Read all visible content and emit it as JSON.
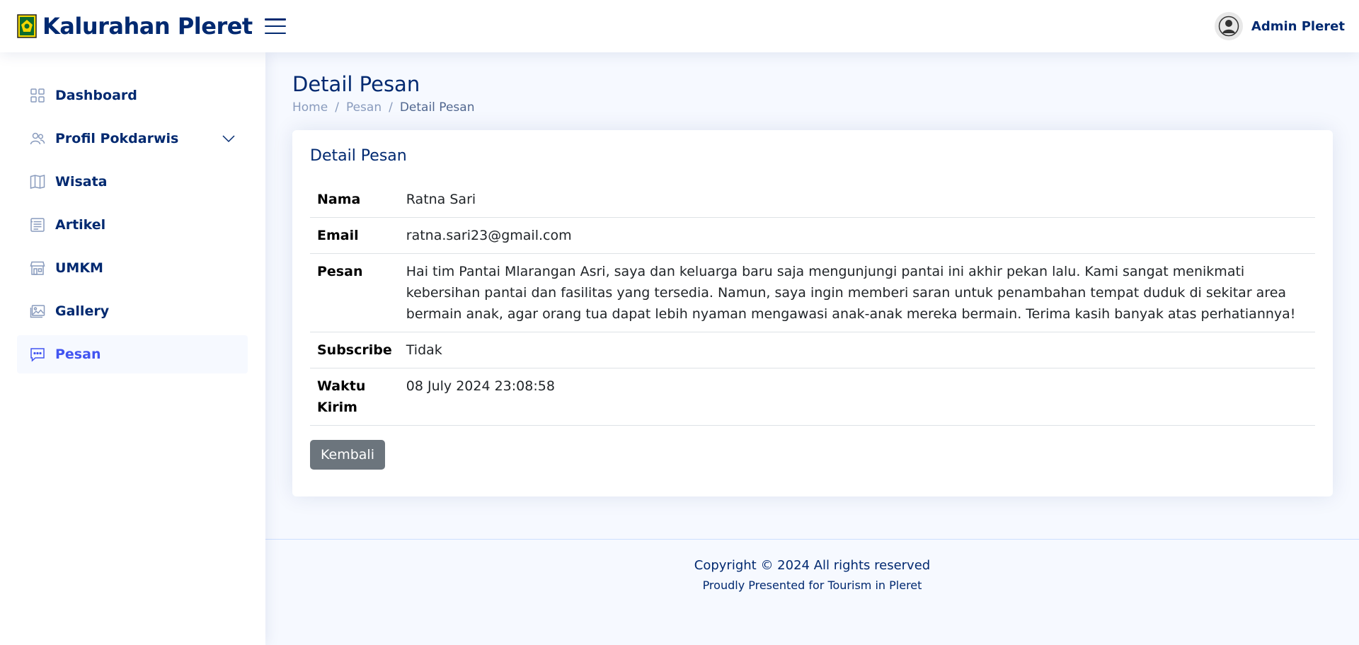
{
  "header": {
    "brand": "Kalurahan Pleret",
    "user_name": "Admin Pleret"
  },
  "sidebar": {
    "items": [
      {
        "label": "Dashboard",
        "icon": "grid-icon"
      },
      {
        "label": "Profil Pokdarwis",
        "icon": "people-icon"
      },
      {
        "label": "Wisata",
        "icon": "map-icon"
      },
      {
        "label": "Artikel",
        "icon": "article-icon"
      },
      {
        "label": "UMKM",
        "icon": "shop-icon"
      },
      {
        "label": "Gallery",
        "icon": "image-icon"
      },
      {
        "label": "Pesan",
        "icon": "chat-icon"
      }
    ]
  },
  "page": {
    "title": "Detail Pesan",
    "breadcrumb": [
      "Home",
      "Pesan",
      "Detail Pesan"
    ]
  },
  "card": {
    "title": "Detail Pesan",
    "rows": [
      {
        "label": "Nama",
        "value": "Ratna Sari"
      },
      {
        "label": "Email",
        "value": "ratna.sari23@gmail.com"
      },
      {
        "label": "Pesan",
        "value": "Hai tim Pantai Mlarangan Asri, saya dan keluarga baru saja mengunjungi pantai ini akhir pekan lalu. Kami sangat menikmati kebersihan pantai dan fasilitas yang tersedia. Namun, saya ingin memberi saran untuk penambahan tempat duduk di sekitar area bermain anak, agar orang tua dapat lebih nyaman mengawasi anak-anak mereka bermain. Terima kasih banyak atas perhatiannya!"
      },
      {
        "label": "Subscribe",
        "value": "Tidak"
      },
      {
        "label": "Waktu Kirim",
        "value": "08 July 2024 23:08:58"
      }
    ],
    "back_label": "Kembali"
  },
  "footer": {
    "copyright": "Copyright © 2024 All rights reserved",
    "credits": "Proudly Presented for Tourism in Pleret"
  },
  "colors": {
    "primary": "#012970",
    "active": "#4154f1",
    "background": "#f6f9ff",
    "button": "#6c757d"
  }
}
